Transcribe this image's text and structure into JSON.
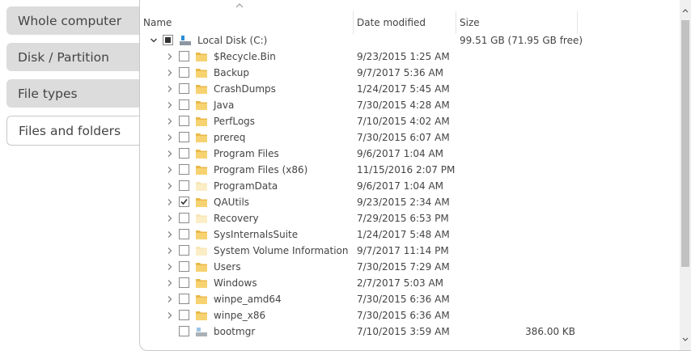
{
  "tabs": [
    {
      "label": "Whole computer",
      "active": false
    },
    {
      "label": "Disk / Partition",
      "active": false
    },
    {
      "label": "File types",
      "active": false
    },
    {
      "label": "Files and folders",
      "active": true
    }
  ],
  "columns": {
    "name": "Name",
    "date": "Date modified",
    "size": "Size"
  },
  "rows": [
    {
      "name": "Local Disk (C:)",
      "date": "",
      "size": "99.51 GB (71.95 GB free)",
      "icon": "drive-icon",
      "chevron": "down",
      "checkbox": "partial",
      "level": 0
    },
    {
      "name": "$Recycle.Bin",
      "date": "9/23/2015 1:25 AM",
      "size": "",
      "icon": "folder-icon",
      "chevron": "right",
      "checkbox": "unchecked",
      "level": 1
    },
    {
      "name": "Backup",
      "date": "9/7/2017 5:36 AM",
      "size": "",
      "icon": "folder-icon",
      "chevron": "right",
      "checkbox": "unchecked",
      "level": 1
    },
    {
      "name": "CrashDumps",
      "date": "1/24/2017 5:45 AM",
      "size": "",
      "icon": "folder-icon",
      "chevron": "right",
      "checkbox": "unchecked",
      "level": 1
    },
    {
      "name": "Java",
      "date": "7/30/2015 4:28 AM",
      "size": "",
      "icon": "folder-icon",
      "chevron": "right",
      "checkbox": "unchecked",
      "level": 1
    },
    {
      "name": "PerfLogs",
      "date": "7/10/2015 4:02 AM",
      "size": "",
      "icon": "folder-icon",
      "chevron": "right",
      "checkbox": "unchecked",
      "level": 1
    },
    {
      "name": "prereq",
      "date": "7/30/2015 6:07 AM",
      "size": "",
      "icon": "folder-icon",
      "chevron": "right",
      "checkbox": "unchecked",
      "level": 1
    },
    {
      "name": "Program Files",
      "date": "9/6/2017 1:04 AM",
      "size": "",
      "icon": "folder-icon",
      "chevron": "right",
      "checkbox": "unchecked",
      "level": 1
    },
    {
      "name": "Program Files (x86)",
      "date": "11/15/2016 2:07 PM",
      "size": "",
      "icon": "folder-icon",
      "chevron": "right",
      "checkbox": "unchecked",
      "level": 1
    },
    {
      "name": "ProgramData",
      "date": "9/6/2017 1:04 AM",
      "size": "",
      "icon": "folder-icon-hidden",
      "chevron": "right",
      "checkbox": "unchecked",
      "level": 1
    },
    {
      "name": "QAUtils",
      "date": "9/23/2015 2:34 AM",
      "size": "",
      "icon": "folder-icon",
      "chevron": "right",
      "checkbox": "checked",
      "level": 1
    },
    {
      "name": "Recovery",
      "date": "7/29/2015 6:53 PM",
      "size": "",
      "icon": "folder-icon-hidden",
      "chevron": "right",
      "checkbox": "unchecked",
      "level": 1
    },
    {
      "name": "SysInternalsSuite",
      "date": "1/24/2017 5:48 AM",
      "size": "",
      "icon": "folder-icon",
      "chevron": "right",
      "checkbox": "unchecked",
      "level": 1
    },
    {
      "name": "System Volume Information",
      "date": "9/7/2017 11:14 PM",
      "size": "",
      "icon": "folder-icon-hidden",
      "chevron": "right",
      "checkbox": "unchecked",
      "level": 1
    },
    {
      "name": "Users",
      "date": "7/30/2015 7:29 AM",
      "size": "",
      "icon": "folder-icon",
      "chevron": "right",
      "checkbox": "unchecked",
      "level": 1
    },
    {
      "name": "Windows",
      "date": "2/7/2017 5:03 AM",
      "size": "",
      "icon": "folder-icon",
      "chevron": "right",
      "checkbox": "unchecked",
      "level": 1
    },
    {
      "name": "winpe_amd64",
      "date": "7/30/2015 6:36 AM",
      "size": "",
      "icon": "folder-icon",
      "chevron": "right",
      "checkbox": "unchecked",
      "level": 1
    },
    {
      "name": "winpe_x86",
      "date": "7/30/2015 6:36 AM",
      "size": "",
      "icon": "folder-icon",
      "chevron": "right",
      "checkbox": "unchecked",
      "level": 1
    },
    {
      "name": "bootmgr",
      "date": "7/10/2015 3:59 AM",
      "size": "386.00 KB",
      "icon": "system-file-icon",
      "chevron": "none",
      "checkbox": "unchecked",
      "level": 1
    }
  ]
}
